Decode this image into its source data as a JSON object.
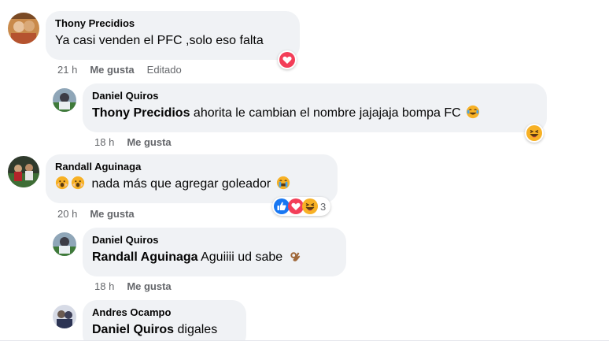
{
  "comments": [
    {
      "author": "Thony Precidios",
      "text": "Ya casi venden el PFC ,solo eso falta",
      "time": "21 h",
      "like_label": "Me gusta",
      "edited_label": "Editado"
    },
    {
      "author": "Daniel Quiros",
      "mention": "Thony Precidios",
      "text": "ahorita le cambian el nombre jajajaja bompa FC",
      "time": "18 h",
      "like_label": "Me gusta"
    },
    {
      "author": "Randall Aguinaga",
      "text": "nada más que agregar goleador",
      "time": "20 h",
      "like_label": "Me gusta",
      "reaction_count": "3"
    },
    {
      "author": "Daniel Quiros",
      "mention": "Randall Aguinaga",
      "text": "Aguiiii ud sabe",
      "time": "18 h",
      "like_label": "Me gusta"
    },
    {
      "author": "Andres Ocampo",
      "mention": "Daniel Quiros",
      "text": "digales"
    }
  ],
  "icons": {
    "love": "heart-reaction-icon",
    "haha": "laughing-reaction-icon",
    "like": "thumbs-up-reaction-icon"
  },
  "colors": {
    "bubble": "#f0f2f5",
    "meta_text": "#65676b",
    "like_blue": "#1877f2",
    "love_red": "#f33e58",
    "haha_yellow": "#f7b125"
  }
}
